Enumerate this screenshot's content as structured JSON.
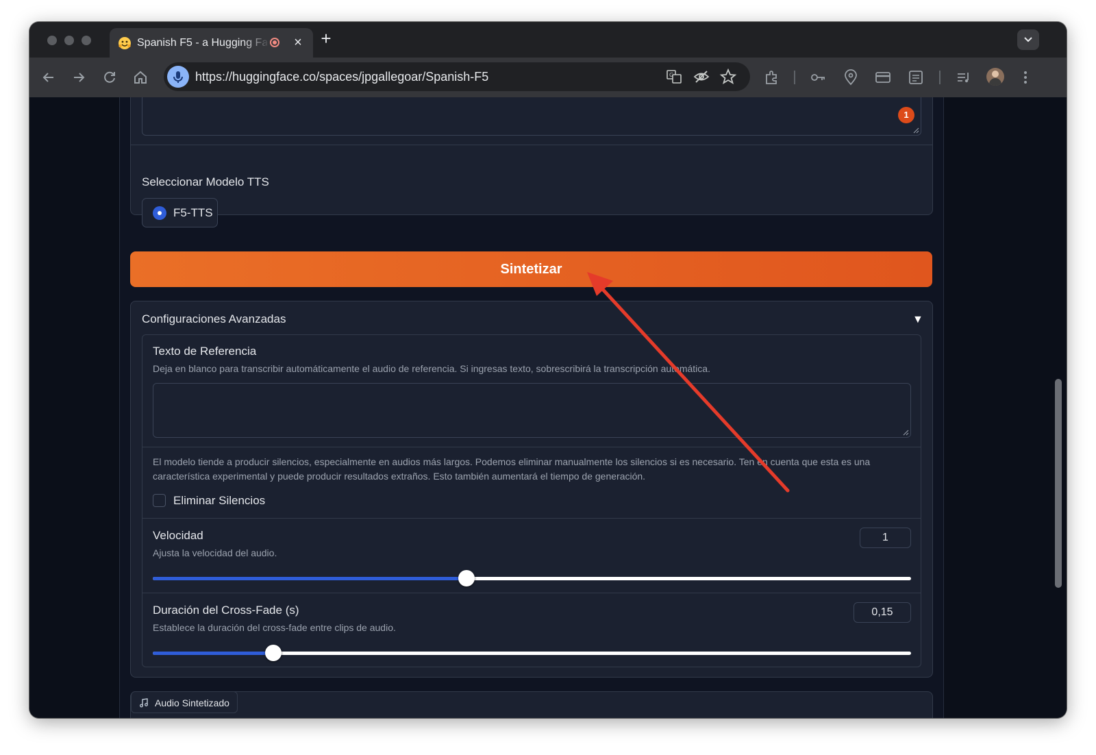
{
  "browser": {
    "tab_title": "Spanish F5 - a Hugging Face Space",
    "new_tab_symbol": "+",
    "close_symbol": "×",
    "url": "https://huggingface.co/spaces/jpgallegoar/Spanish-F5"
  },
  "app": {
    "text_badge": "1",
    "model_label": "Seleccionar Modelo TTS",
    "model_option": "F5-TTS",
    "synthesize_button": "Sintetizar",
    "advanced": {
      "title": "Configuraciones Avanzadas",
      "caret": "▼",
      "ref_text_label": "Texto de Referencia",
      "ref_text_info": "Deja en blanco para transcribir automáticamente el audio de referencia. Si ingresas texto, sobrescribirá la transcripción automática.",
      "ref_text_value": "",
      "silence_info": "El modelo tiende a producir silencios, especialmente en audios más largos. Podemos eliminar manualmente los silencios si es necesario. Ten en cuenta que esta es una característica experimental y puede producir resultados extraños. Esto también aumentará el tiempo de generación.",
      "remove_silence_label": "Eliminar Silencios",
      "remove_silence_checked": false,
      "speed": {
        "label": "Velocidad",
        "info": "Ajusta la velocidad del audio.",
        "value_text": "1",
        "fraction": 0.414
      },
      "crossfade": {
        "label": "Duración del Cross-Fade (s)",
        "info": "Establece la duración del cross-fade entre clips de audio.",
        "value_text": "0,15",
        "fraction": 0.159
      }
    },
    "output_tab": "Audio Sintetizado"
  },
  "colors": {
    "accent_orange": "#e8632a",
    "slider_blue": "#2f5dd9",
    "badge_red": "#dd4b1a",
    "annotation_arrow": "#e53b2a"
  },
  "icons": [
    "mic-icon",
    "translate-icon",
    "eye-off-icon",
    "star-icon",
    "extension-icon",
    "key-icon",
    "location-icon",
    "card-icon",
    "reading-list-icon",
    "media-icon",
    "avatar",
    "kebab-menu-icon",
    "music-note-icon",
    "chevron-down-icon"
  ]
}
